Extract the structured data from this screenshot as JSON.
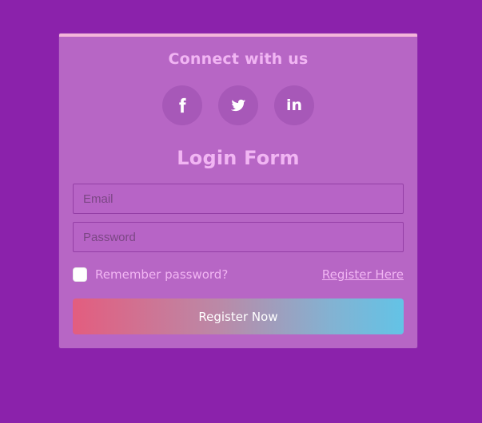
{
  "page": {
    "colors": {
      "background": "#8b22ab",
      "card": "#b766c5",
      "accent_strip": "#f4b5da",
      "title_text": "#f1b5f3"
    }
  },
  "card": {
    "connect_title": "Connect with us",
    "social": {
      "facebook_icon": "facebook-icon",
      "twitter_icon": "twitter-icon",
      "linkedin_icon": "linkedin-icon",
      "linkedin_label": "in"
    },
    "form_title": "Login Form",
    "email_placeholder": "Email",
    "password_placeholder": "Password",
    "remember_label": "Remember password?",
    "register_here_label": "Register Here",
    "register_now_label": "Register Now"
  }
}
